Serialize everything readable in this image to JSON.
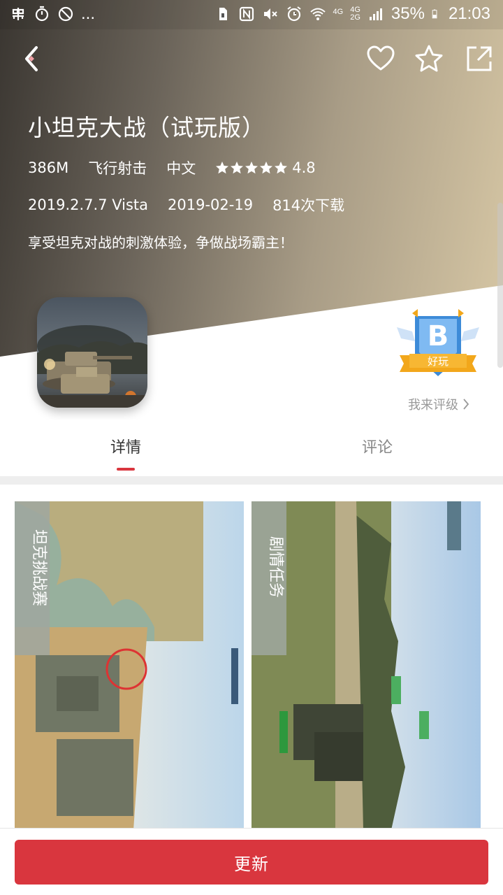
{
  "statusbar": {
    "left_icons": [
      "bug-icon",
      "stopwatch-icon",
      "blocked-icon"
    ],
    "overflow": "...",
    "right_icons": [
      "sim-icon",
      "nfc-icon",
      "mute-icon",
      "alarm-icon",
      "wifi-icon",
      "signal-icon"
    ],
    "net_top": "4G",
    "net_a": "4G",
    "net_b": "2G",
    "battery": "35%",
    "time": "21:03"
  },
  "header": {
    "actions": [
      "back-icon",
      "favorite-icon",
      "star-icon",
      "share-icon"
    ]
  },
  "app": {
    "title": "小坦克大战（试玩版）",
    "size": "386M",
    "category": "飞行射击",
    "language": "中文",
    "rating": "4.8",
    "star_count": 5,
    "version": "2019.2.7.7 Vista",
    "date": "2019-02-19",
    "downloads": "814次下载",
    "description": "享受坦克对战的刺激体验，争做战场霸主！"
  },
  "badge": {
    "grade": "B",
    "label": "好玩",
    "rate_link": "我来评级"
  },
  "tabs": [
    {
      "label": "详情",
      "active": true
    },
    {
      "label": "评论",
      "active": false
    }
  ],
  "screenshots": [
    {
      "caption": "坦克挑战赛"
    },
    {
      "caption": "剧情任务"
    }
  ],
  "bottom": {
    "button_label": "更新"
  },
  "colors": {
    "accent": "#d9363e",
    "badge_blue": "#4a90e2",
    "badge_gold": "#f2a71b"
  }
}
